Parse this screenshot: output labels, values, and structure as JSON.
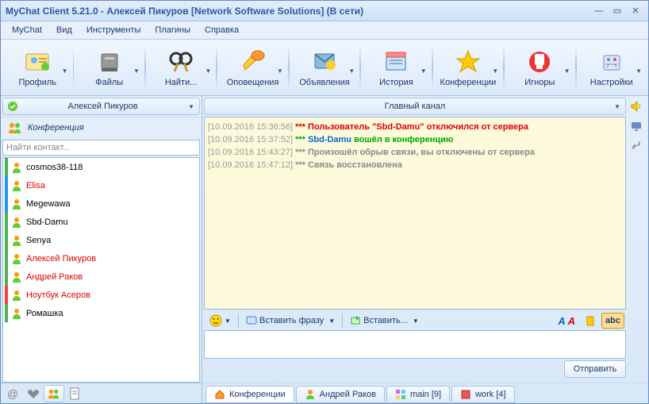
{
  "window": {
    "title": "MyChat Client 5.21.0 - Алексей Пикуров [Network Software Solutions] (В сети)"
  },
  "menu": {
    "items": [
      "MyChat",
      "Вид",
      "Инструменты",
      "Плагины",
      "Справка"
    ]
  },
  "toolbar": {
    "items": [
      {
        "label": "Профиль",
        "icon": "profile"
      },
      {
        "label": "Файлы",
        "icon": "files"
      },
      {
        "label": "Найти...",
        "icon": "find"
      },
      {
        "label": "Оповещения",
        "icon": "alerts"
      },
      {
        "label": "Объявления",
        "icon": "announcements"
      },
      {
        "label": "История",
        "icon": "history"
      },
      {
        "label": "Конференции",
        "icon": "conferences"
      },
      {
        "label": "Игноры",
        "icon": "ignores"
      },
      {
        "label": "Настройки",
        "icon": "settings"
      }
    ]
  },
  "sidebar": {
    "user": "Алексей Пикуров",
    "section_title": "Конференция",
    "search_placeholder": "Найти контакт...",
    "contacts": [
      {
        "name": "cosmos38-118",
        "color": "black",
        "status": "green"
      },
      {
        "name": "Elisa",
        "color": "red",
        "status": "blue"
      },
      {
        "name": "Megewawa",
        "color": "black",
        "status": "blue"
      },
      {
        "name": "Sbd-Damu",
        "color": "black",
        "status": "green"
      },
      {
        "name": "Senya",
        "color": "black",
        "status": "green"
      },
      {
        "name": "Алексей Пикуров",
        "color": "red",
        "status": "green"
      },
      {
        "name": "Андрей Раков",
        "color": "red",
        "status": "green"
      },
      {
        "name": "Ноутбук Асеров",
        "color": "red",
        "status": "red"
      },
      {
        "name": "Ромашка",
        "color": "black",
        "status": "green"
      }
    ]
  },
  "chat": {
    "channel": "Главный канал",
    "log": [
      {
        "ts": "[10.09.2016 15:36:56]",
        "parts": [
          {
            "t": " *** ",
            "c": "#d00",
            "b": true
          },
          {
            "t": "Пользователь \"Sbd-Damu\" отключился от сервера",
            "c": "#d00",
            "b": true
          }
        ]
      },
      {
        "ts": "[10.09.2016 15:37:52]",
        "parts": [
          {
            "t": " *** ",
            "c": "#0a0",
            "b": true
          },
          {
            "t": "Sbd-Damu",
            "c": "#06c",
            "b": true
          },
          {
            "t": " вошёл в конференцию",
            "c": "#0a0",
            "b": true
          }
        ]
      },
      {
        "ts": "[10.09.2016 15:43:27]",
        "parts": [
          {
            "t": " *** ",
            "c": "#888",
            "b": true
          },
          {
            "t": "Произошёл обрыв связи, вы отключены от сервера",
            "c": "#888",
            "b": true
          }
        ]
      },
      {
        "ts": "[10.09.2016 15:47:12]",
        "parts": [
          {
            "t": " *** ",
            "c": "#888",
            "b": true
          },
          {
            "t": "Связь восстановлена",
            "c": "#888",
            "b": true
          }
        ]
      }
    ],
    "edit": {
      "phrase": "Вставить фразу",
      "insert": "Вставить..."
    },
    "send": "Отправить"
  },
  "tabs": {
    "items": [
      {
        "label": "Конференции",
        "icon": "home",
        "active": true
      },
      {
        "label": "Андрей Раков",
        "icon": "person",
        "active": false
      },
      {
        "label": "main [9]",
        "icon": "grid",
        "active": false
      },
      {
        "label": "work [4]",
        "icon": "folder",
        "active": false
      }
    ]
  }
}
